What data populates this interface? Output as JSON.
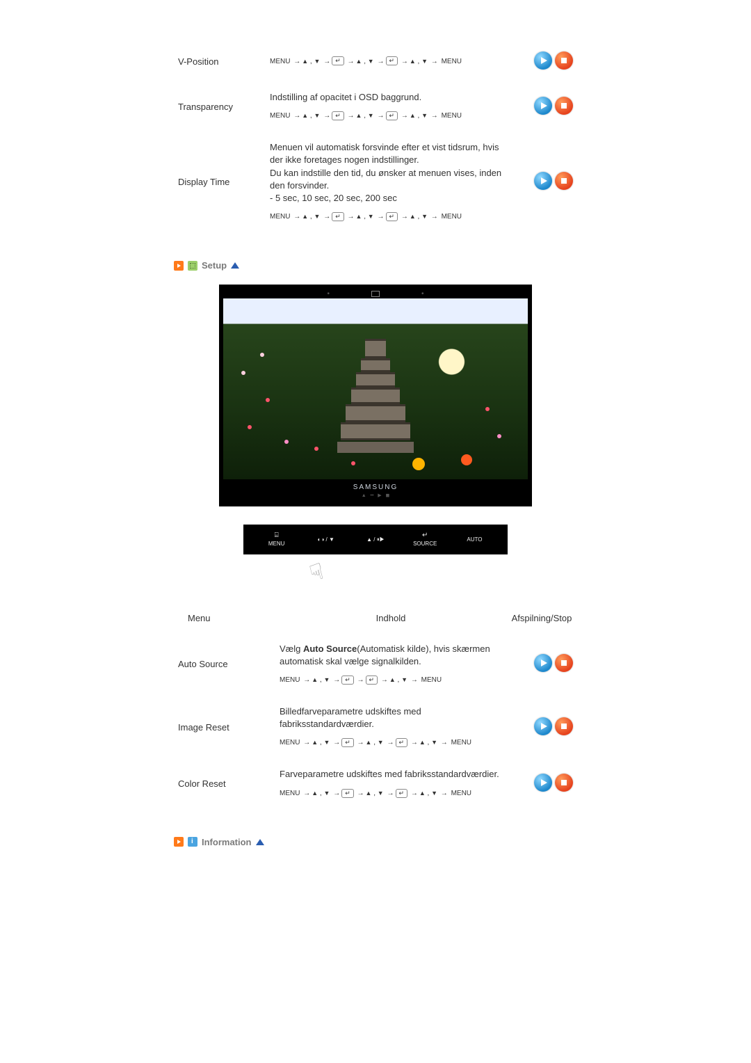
{
  "osd_rows": {
    "vposition": {
      "label": "V-Position",
      "path_prefix": "MENU",
      "path_suffix": "MENU"
    },
    "transparency": {
      "label": "Transparency",
      "desc": "Indstilling af opacitet i OSD baggrund.",
      "path_prefix": "MENU",
      "path_suffix": "MENU"
    },
    "display_time": {
      "label": "Display Time",
      "desc_line1": "Menuen vil automatisk forsvinde efter et vist tidsrum, hvis der ikke foretages nogen indstillinger.",
      "desc_line2": "Du kan indstille den tid, du ønsker at menuen vises, inden den forsvinder.",
      "desc_line3": "- 5 sec, 10 sec, 20 sec, 200 sec",
      "path_prefix": "MENU",
      "path_suffix": "MENU"
    }
  },
  "section_setup": "Setup",
  "section_information": "Information",
  "preview": {
    "brand": "SAMSUNG",
    "controls": {
      "menu_icon": "⌸",
      "menu": "MENU",
      "mid1": "◐◑ / ▼",
      "mid2": "▲ / ⏸▶",
      "source_icon": "↵",
      "source": "SOURCE",
      "auto": "AUTO"
    }
  },
  "setup_table": {
    "headers": {
      "menu": "Menu",
      "content": "Indhold",
      "actions": "Afspilning/Stop"
    },
    "rows": {
      "auto_source": {
        "label": "Auto Source",
        "desc_pre": "Vælg ",
        "desc_bold": "Auto Source",
        "desc_post": "(Automatisk kilde), hvis skærmen automatisk skal vælge signalkilden.",
        "path_prefix": "MENU",
        "path_suffix": "MENU"
      },
      "image_reset": {
        "label": "Image Reset",
        "desc": "Billedfarveparametre udskiftes med fabriksstandardværdier.",
        "path_prefix": "MENU",
        "path_suffix": "MENU"
      },
      "color_reset": {
        "label": "Color Reset",
        "desc": "Farveparametre udskiftes med fabriksstandardværdier.",
        "path_prefix": "MENU",
        "path_suffix": "MENU"
      }
    }
  }
}
